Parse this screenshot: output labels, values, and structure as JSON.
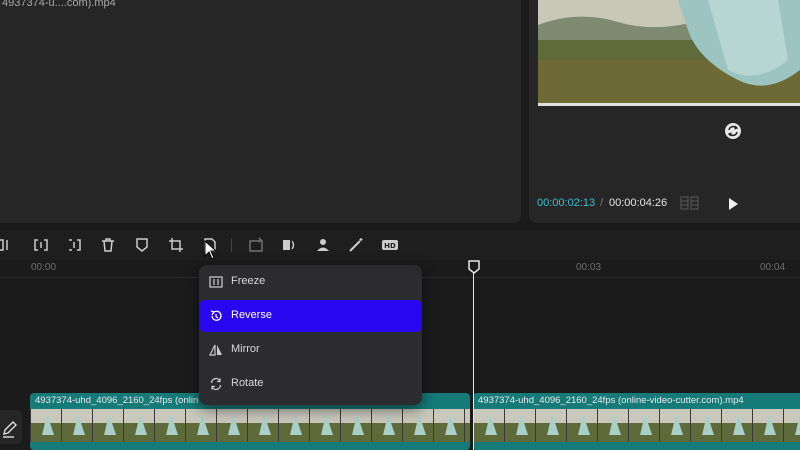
{
  "media": {
    "file_name": "4937374-u....com).mp4"
  },
  "preview": {
    "current_time": "00:00:02:13",
    "separator": "/",
    "total_time": "00:00:04:26"
  },
  "toolbar": {
    "tools": [
      "split-left-icon",
      "split-icon",
      "split-right-icon",
      "delete-icon",
      "marker-icon",
      "crop-icon",
      "transform-icon",
      "extract-audio-icon",
      "audio-icon",
      "person-icon",
      "magic-wand-icon",
      "hd-icon"
    ]
  },
  "ruler": {
    "ticks": [
      "00:00",
      "00:03",
      "00:04"
    ]
  },
  "context_menu": {
    "items": [
      {
        "label": "Freeze",
        "icon": "freeze-icon"
      },
      {
        "label": "Reverse",
        "icon": "reverse-icon",
        "active": true
      },
      {
        "label": "Mirror",
        "icon": "mirror-icon"
      },
      {
        "label": "Rotate",
        "icon": "rotate-icon"
      }
    ],
    "active_color": "#2a05f0"
  },
  "timeline": {
    "clips": [
      {
        "label": "4937374-uhd_4096_2160_24fps (onlin"
      },
      {
        "label": "4937374-uhd_4096_2160_24fps (online-video-cutter.com).mp4"
      }
    ],
    "clip_color": "#157a78",
    "playhead_color": "#e6e6e6"
  },
  "accent_time_color": "#39c0d3"
}
